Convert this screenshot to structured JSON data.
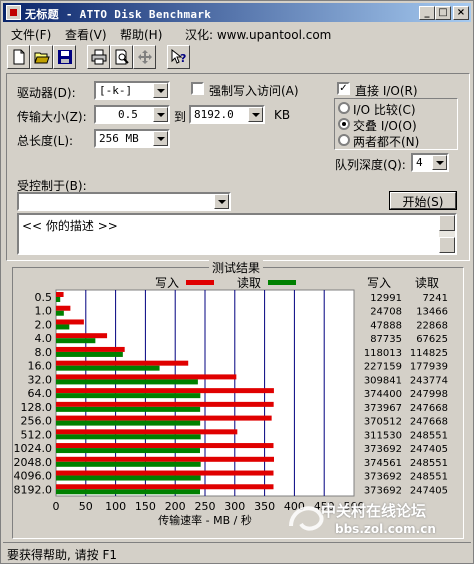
{
  "window": {
    "title": "无标题 - ATTO Disk Benchmark",
    "minimize": "_",
    "maximize": "□",
    "close": "×"
  },
  "menu": {
    "file": "文件(F)",
    "view": "查看(V)",
    "help": "帮助(H)",
    "localized": "汉化: www.upantool.com"
  },
  "toolbar": {
    "buttons": [
      "new-file-icon",
      "open-folder-icon",
      "save-disk-icon",
      "print-icon",
      "print-preview-icon",
      "move-icon",
      "context-help-icon"
    ]
  },
  "settings": {
    "drive_label": "驱动器(D):",
    "drive_value": "[-k-]",
    "force_write_label": "强制写入访问(A)",
    "transfer_size_label": "传输大小(Z):",
    "transfer_from": "0.5",
    "to_label": "到",
    "transfer_to": "8192.0",
    "kb_label": "KB",
    "total_length_label": "总长度(L):",
    "total_length_value": "256 MB",
    "direct_io_label": "直接 I/O(R)",
    "radio_io_compare": "I/O 比较(C)",
    "radio_overlap_io": "交叠 I/O(O)",
    "radio_neither": "两者都不(N)",
    "queue_depth_label": "队列深度(Q):",
    "queue_depth_value": "4",
    "controlled_by_label": "受控制于(B):",
    "controlled_by_value": "",
    "start_button": "开始(S)",
    "description": "<<  你的描述   >>"
  },
  "results": {
    "group_title": "测试结果",
    "legend_write": "写入",
    "legend_read": "读取",
    "col_write": "写入",
    "col_read": "读取"
  },
  "chart_data": {
    "type": "bar",
    "orientation": "horizontal",
    "categories": [
      "0.5",
      "1.0",
      "2.0",
      "4.0",
      "8.0",
      "16.0",
      "32.0",
      "64.0",
      "128.0",
      "256.0",
      "512.0",
      "1024.0",
      "2048.0",
      "4096.0",
      "8192.0"
    ],
    "series": [
      {
        "name": "写入",
        "color": "#e00000",
        "values": [
          12991,
          24708,
          47888,
          87735,
          118013,
          227159,
          309841,
          374400,
          373967,
          370512,
          311530,
          373692,
          374561,
          373692,
          373692
        ]
      },
      {
        "name": "读取",
        "color": "#008000",
        "values": [
          7241,
          13466,
          22868,
          67625,
          114825,
          177939,
          243774,
          247998,
          247668,
          247668,
          248551,
          247405,
          248551,
          248551,
          247405
        ]
      }
    ],
    "xlabel": "传输速率 - MB / 秒",
    "xticks": [
      "0",
      "50",
      "100",
      "150",
      "200",
      "250",
      "300",
      "350",
      "400",
      "450",
      "500"
    ],
    "xlim": [
      0,
      500
    ],
    "value_unit": "KB/s",
    "grid": true
  },
  "status": {
    "text": "要获得帮助, 请按 F1"
  },
  "watermark": {
    "text": "中关村在线论坛",
    "url": "bbs.zol.com.cn"
  }
}
